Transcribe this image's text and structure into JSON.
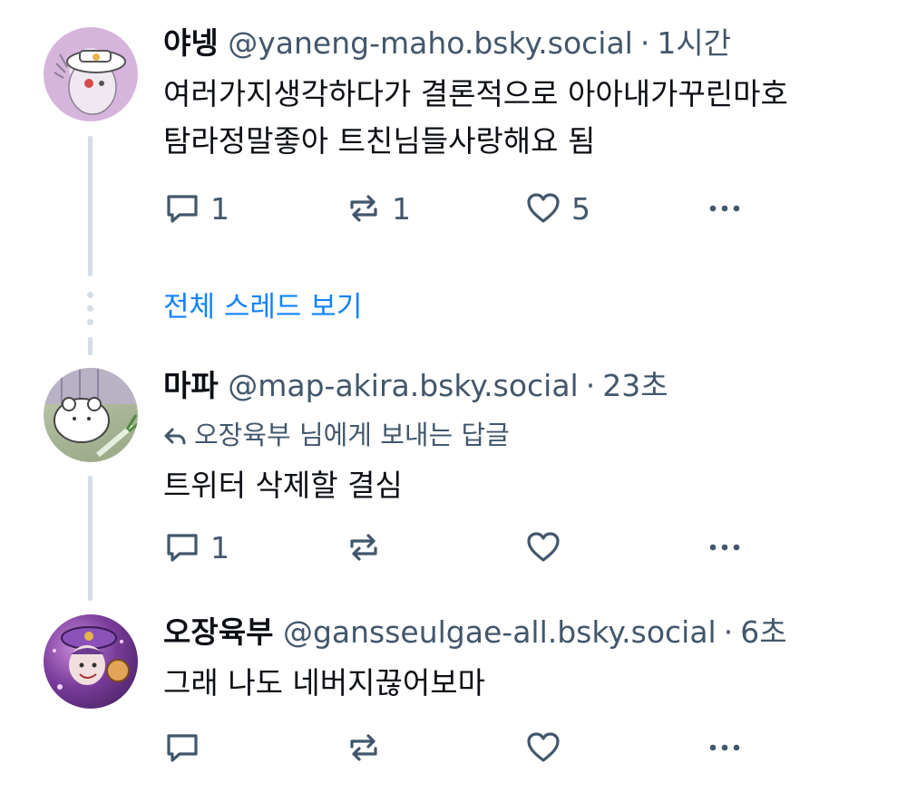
{
  "posts": [
    {
      "name": "야넹",
      "handle": "@yaneng-maho.bsky.social",
      "time": "1시간",
      "reply_to": "",
      "lines": [
        "여러가지생각하다가 결론적으로 아아내가꾸린마호",
        "탐라정말좋아 트친님들사랑해요 됨"
      ],
      "reply_count": "1",
      "repost_count": "1",
      "like_count": "5"
    },
    {
      "name": "마파",
      "handle": "@map-akira.bsky.social",
      "time": "23초",
      "reply_to": "오장육부 님에게 보내는 답글",
      "lines": [
        "트위터 삭제할 결심"
      ],
      "reply_count": "1",
      "repost_count": "",
      "like_count": ""
    },
    {
      "name": "오장육부",
      "handle": "@gansseulgae-all.bsky.social",
      "time": "6초",
      "reply_to": "",
      "lines": [
        "그래 나도 네버지끊어보마"
      ],
      "reply_count": "",
      "repost_count": "",
      "like_count": ""
    }
  ],
  "see_full_thread": "전체 스레드 보기",
  "icons": {
    "reply": "speech-bubble-icon",
    "repost": "repost-arrows-icon",
    "like": "heart-icon",
    "more": "more-dots-icon",
    "reply_arrow": "reply-arrow-icon"
  },
  "colors": {
    "text": "#0b0f14",
    "muted": "#42576c",
    "link": "#1083fe",
    "thread_line": "#d5dde6"
  }
}
